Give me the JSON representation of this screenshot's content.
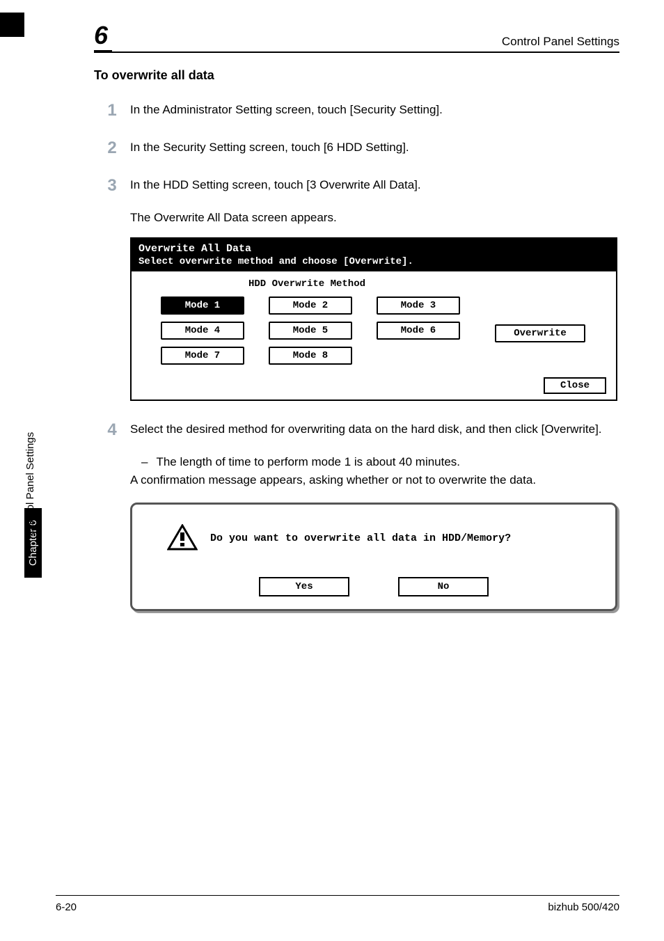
{
  "sidebar": {
    "chapter_label": "Chapter 6",
    "section_label": "Control Panel Settings"
  },
  "header": {
    "chapter_number": "6",
    "title": "Control Panel Settings"
  },
  "section_title": "To overwrite all data",
  "steps": [
    {
      "num": "1",
      "text": "In the Administrator Setting screen, touch [Security Setting]."
    },
    {
      "num": "2",
      "text": "In the Security Setting screen, touch [6 HDD Setting]."
    },
    {
      "num": "3",
      "text": "In the HDD Setting screen, touch [3 Overwrite All Data]."
    }
  ],
  "step3_subtext": "The Overwrite All Data screen appears.",
  "screen1": {
    "title": "Overwrite All Data",
    "subtitle": "Select overwrite method and choose [Overwrite].",
    "method_label": "HDD Overwrite Method",
    "modes": [
      "Mode 1",
      "Mode 2",
      "Mode 3",
      "Mode 4",
      "Mode 5",
      "Mode 6",
      "Mode 7",
      "Mode 8"
    ],
    "overwrite_btn": "Overwrite",
    "close_btn": "Close"
  },
  "step4": {
    "num": "4",
    "text": "Select the desired method for overwriting data on the hard disk, and then click [Overwrite].",
    "bullet": "The length of time to perform mode 1 is about 40 minutes.",
    "followup": "A confirmation message appears, asking whether or not to overwrite the data."
  },
  "dialog": {
    "text": "Do you want to overwrite all data in HDD/Memory?",
    "yes": "Yes",
    "no": "No"
  },
  "footer": {
    "page": "6-20",
    "product": "bizhub 500/420"
  }
}
